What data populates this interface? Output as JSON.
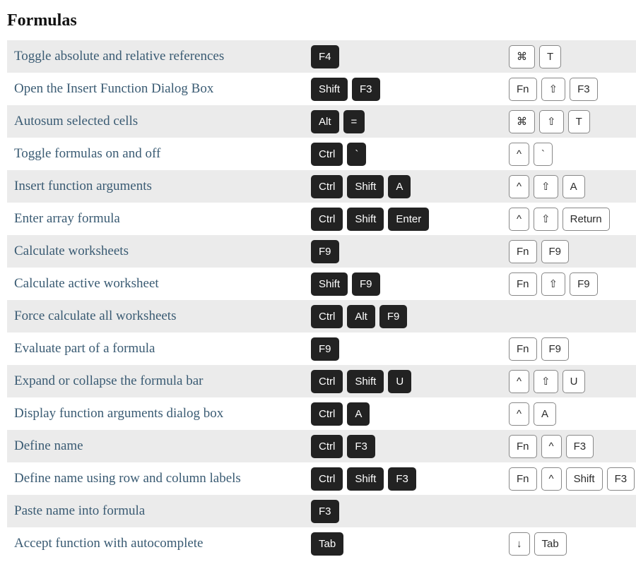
{
  "title": "Formulas",
  "rows": [
    {
      "desc": "Toggle absolute and relative references",
      "win": [
        "F4"
      ],
      "mac": [
        "⌘",
        "T"
      ]
    },
    {
      "desc": "Open the Insert Function Dialog Box",
      "win": [
        "Shift",
        "F3"
      ],
      "mac": [
        "Fn",
        "⇧",
        "F3"
      ]
    },
    {
      "desc": "Autosum selected cells",
      "win": [
        "Alt",
        "="
      ],
      "mac": [
        "⌘",
        "⇧",
        "T"
      ]
    },
    {
      "desc": "Toggle formulas on and off",
      "win": [
        "Ctrl",
        "`"
      ],
      "mac": [
        "^",
        "`"
      ]
    },
    {
      "desc": "Insert function arguments",
      "win": [
        "Ctrl",
        "Shift",
        "A"
      ],
      "mac": [
        "^",
        "⇧",
        "A"
      ]
    },
    {
      "desc": "Enter array formula",
      "win": [
        "Ctrl",
        "Shift",
        "Enter"
      ],
      "mac": [
        "^",
        "⇧",
        "Return"
      ]
    },
    {
      "desc": "Calculate worksheets",
      "win": [
        "F9"
      ],
      "mac": [
        "Fn",
        "F9"
      ]
    },
    {
      "desc": "Calculate active worksheet",
      "win": [
        "Shift",
        "F9"
      ],
      "mac": [
        "Fn",
        "⇧",
        "F9"
      ]
    },
    {
      "desc": "Force calculate all worksheets",
      "win": [
        "Ctrl",
        "Alt",
        "F9"
      ],
      "mac": []
    },
    {
      "desc": "Evaluate part of a formula",
      "win": [
        "F9"
      ],
      "mac": [
        "Fn",
        "F9"
      ]
    },
    {
      "desc": "Expand or collapse the formula bar",
      "win": [
        "Ctrl",
        "Shift",
        "U"
      ],
      "mac": [
        "^",
        "⇧",
        "U"
      ]
    },
    {
      "desc": "Display function arguments dialog box",
      "win": [
        "Ctrl",
        "A"
      ],
      "mac": [
        "^",
        "A"
      ]
    },
    {
      "desc": "Define name",
      "win": [
        "Ctrl",
        "F3"
      ],
      "mac": [
        "Fn",
        "^",
        "F3"
      ]
    },
    {
      "desc": "Define name using row and column labels",
      "win": [
        "Ctrl",
        "Shift",
        "F3"
      ],
      "mac": [
        "Fn",
        "^",
        "Shift",
        "F3"
      ]
    },
    {
      "desc": "Paste name into formula",
      "win": [
        "F3"
      ],
      "mac": []
    },
    {
      "desc": "Accept function with autocomplete",
      "win": [
        "Tab"
      ],
      "mac": [
        "↓",
        "Tab"
      ]
    }
  ]
}
